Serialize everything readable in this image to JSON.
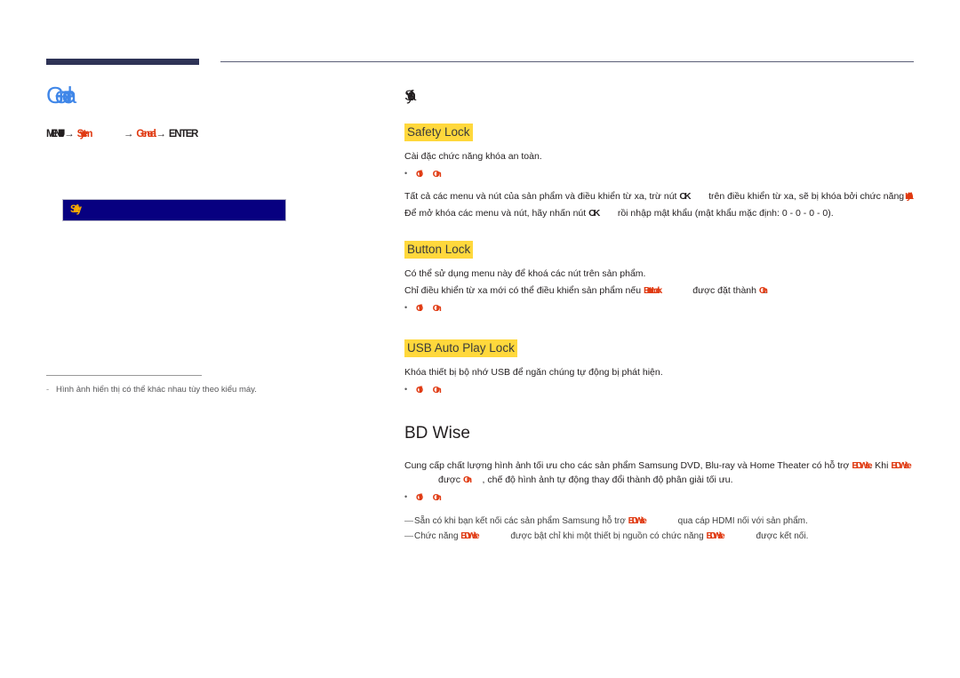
{
  "page": {
    "chapter_title": "General",
    "menu_path": {
      "menu_label": "MENU",
      "menu_icon": "III",
      "arrow": "→",
      "step1": "System",
      "step2": "General",
      "enter": "ENTER"
    },
    "menu_box_label": "Safety",
    "left_note": "Hình ảnh hiển thị có thể khác nhau tùy theo kiểu máy.",
    "left_note_dash": "-"
  },
  "safety": {
    "heading": "Safety",
    "safety_lock": {
      "title": "Safety Lock",
      "desc": "Cài đặc chức năng khóa an toàn.",
      "option_off": "Off",
      "option_on": "On",
      "para1_a": "Tất cả các menu và nút của sản phẩm và điều khiển từ xa, trừ nút",
      "para1_ok": "OK",
      "para1_b": "trên điều khiển từ xa, sẽ bị khóa bởi chức năng",
      "para1_token": "Safety Lock",
      "para2_a": "Để mở khóa các menu và nút, hãy nhấn nút",
      "para2_ok": "OK",
      "para2_b": "rồi nhập mật khẩu (mật khẩu mặc định: 0 - 0 - 0 - 0)."
    },
    "button_lock": {
      "title": "Button Lock",
      "desc": "Có thể sử dụng menu này để khoá các nút trên sản phẩm.",
      "para_a": "Chỉ điều khiển từ xa mới có thể điều khiển sản phẩm nếu",
      "para_token": "Button Lock",
      "para_b": "được đặt thành",
      "para_on": "On",
      "para_end": ".",
      "option_off": "Off",
      "option_on": "On"
    },
    "usb_auto_play_lock": {
      "title": "USB Auto Play Lock",
      "desc": "Khóa thiết bị bộ nhớ USB để ngăn chúng tự động bị phát hiện.",
      "option_off": "Off",
      "option_on": "On"
    }
  },
  "bd_wise": {
    "title": "BD Wise",
    "para_a": "Cung cấp chất lượng hình ảnh tối ưu cho các sản phẩm Samsung DVD, Blu-ray và Home Theater có hỗ trợ",
    "token1": "BD Wise",
    "para_b": ". Khi",
    "token2": "BD Wise",
    "para_c": "được",
    "token_on": "On",
    "para_d": ", chế độ hình ảnh tự động thay đổi thành độ phân giải tối ưu.",
    "option_off": "Off",
    "option_on": "On",
    "footnotes": [
      {
        "lead": "—",
        "a": "Sẵn có khi bạn kết nối các sản phẩm Samsung hỗ trợ",
        "token": "BD Wise",
        "b": "qua cáp HDMI nối với sản phẩm."
      },
      {
        "lead": "—",
        "a": "Chức năng",
        "token": "BD Wise",
        "b": "được bật chỉ khi một thiết bị nguồn có chức năng",
        "token2": "BD Wise",
        "c": "được kết nối."
      }
    ]
  },
  "colors": {
    "chapter_blue": "#3f86e8",
    "rule_navy": "#2e3356",
    "menu_box_navy": "#070080",
    "menu_box_text": "#f5a800",
    "highlight_yellow": "#ffd83c",
    "accent_red": "#e03a12",
    "body_text": "#231f20"
  }
}
